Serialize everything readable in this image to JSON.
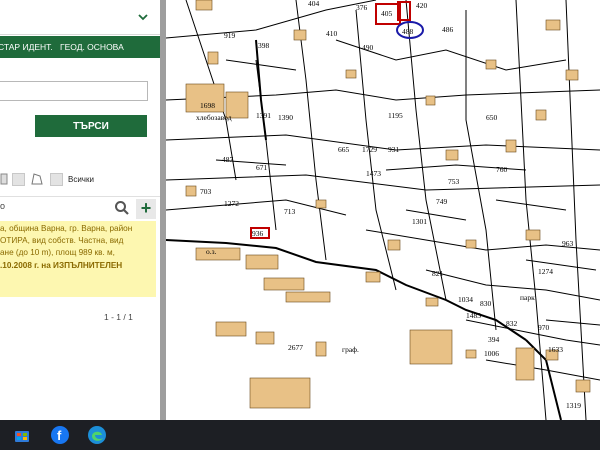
{
  "panel": {
    "tabs": [
      "СТАР ИДЕНТ.",
      "ГЕОД. ОСНОВА"
    ],
    "search_button": "ТЪРСИ",
    "filter_all": "Всички",
    "result_lines": [
      "а, община Варна, гр. Варна, район",
      "ОТИРА, вид собств. Частна, вид",
      "ане (до 10 m), площ 989 кв. м,",
      ".10.2008 г. на ИЗПЪЛНИТЕЛЕН"
    ],
    "pagination": "1 - 1 / 1"
  },
  "map": {
    "labels": [
      {
        "text": "404"
      },
      {
        "text": "376"
      },
      {
        "text": "405"
      },
      {
        "text": "420"
      },
      {
        "text": "488"
      },
      {
        "text": "486"
      },
      {
        "text": "919"
      },
      {
        "text": "398"
      },
      {
        "text": "410"
      },
      {
        "text": "490"
      },
      {
        "text": "1698"
      },
      {
        "text": "хлебозавод"
      },
      {
        "text": "1391"
      },
      {
        "text": "1390"
      },
      {
        "text": "1195"
      },
      {
        "text": "650"
      },
      {
        "text": "665"
      },
      {
        "text": "1729"
      },
      {
        "text": "931"
      },
      {
        "text": "753"
      },
      {
        "text": "760"
      },
      {
        "text": "487"
      },
      {
        "text": "703"
      },
      {
        "text": "671"
      },
      {
        "text": "1272"
      },
      {
        "text": "713"
      },
      {
        "text": "1473"
      },
      {
        "text": "1301"
      },
      {
        "text": "749"
      },
      {
        "text": "936"
      },
      {
        "text": "821"
      },
      {
        "text": "1274"
      },
      {
        "text": "830"
      },
      {
        "text": "832"
      },
      {
        "text": "970"
      },
      {
        "text": "2677"
      },
      {
        "text": "граф."
      },
      {
        "text": "1006"
      },
      {
        "text": "394"
      },
      {
        "text": "1633"
      },
      {
        "text": "963"
      },
      {
        "text": "о.з."
      },
      {
        "text": "парк"
      },
      {
        "text": "1034"
      },
      {
        "text": "1319"
      },
      {
        "text": "1483"
      }
    ]
  },
  "taskbar": {
    "icons": [
      "store-icon",
      "facebook-icon",
      "edge-icon"
    ]
  }
}
